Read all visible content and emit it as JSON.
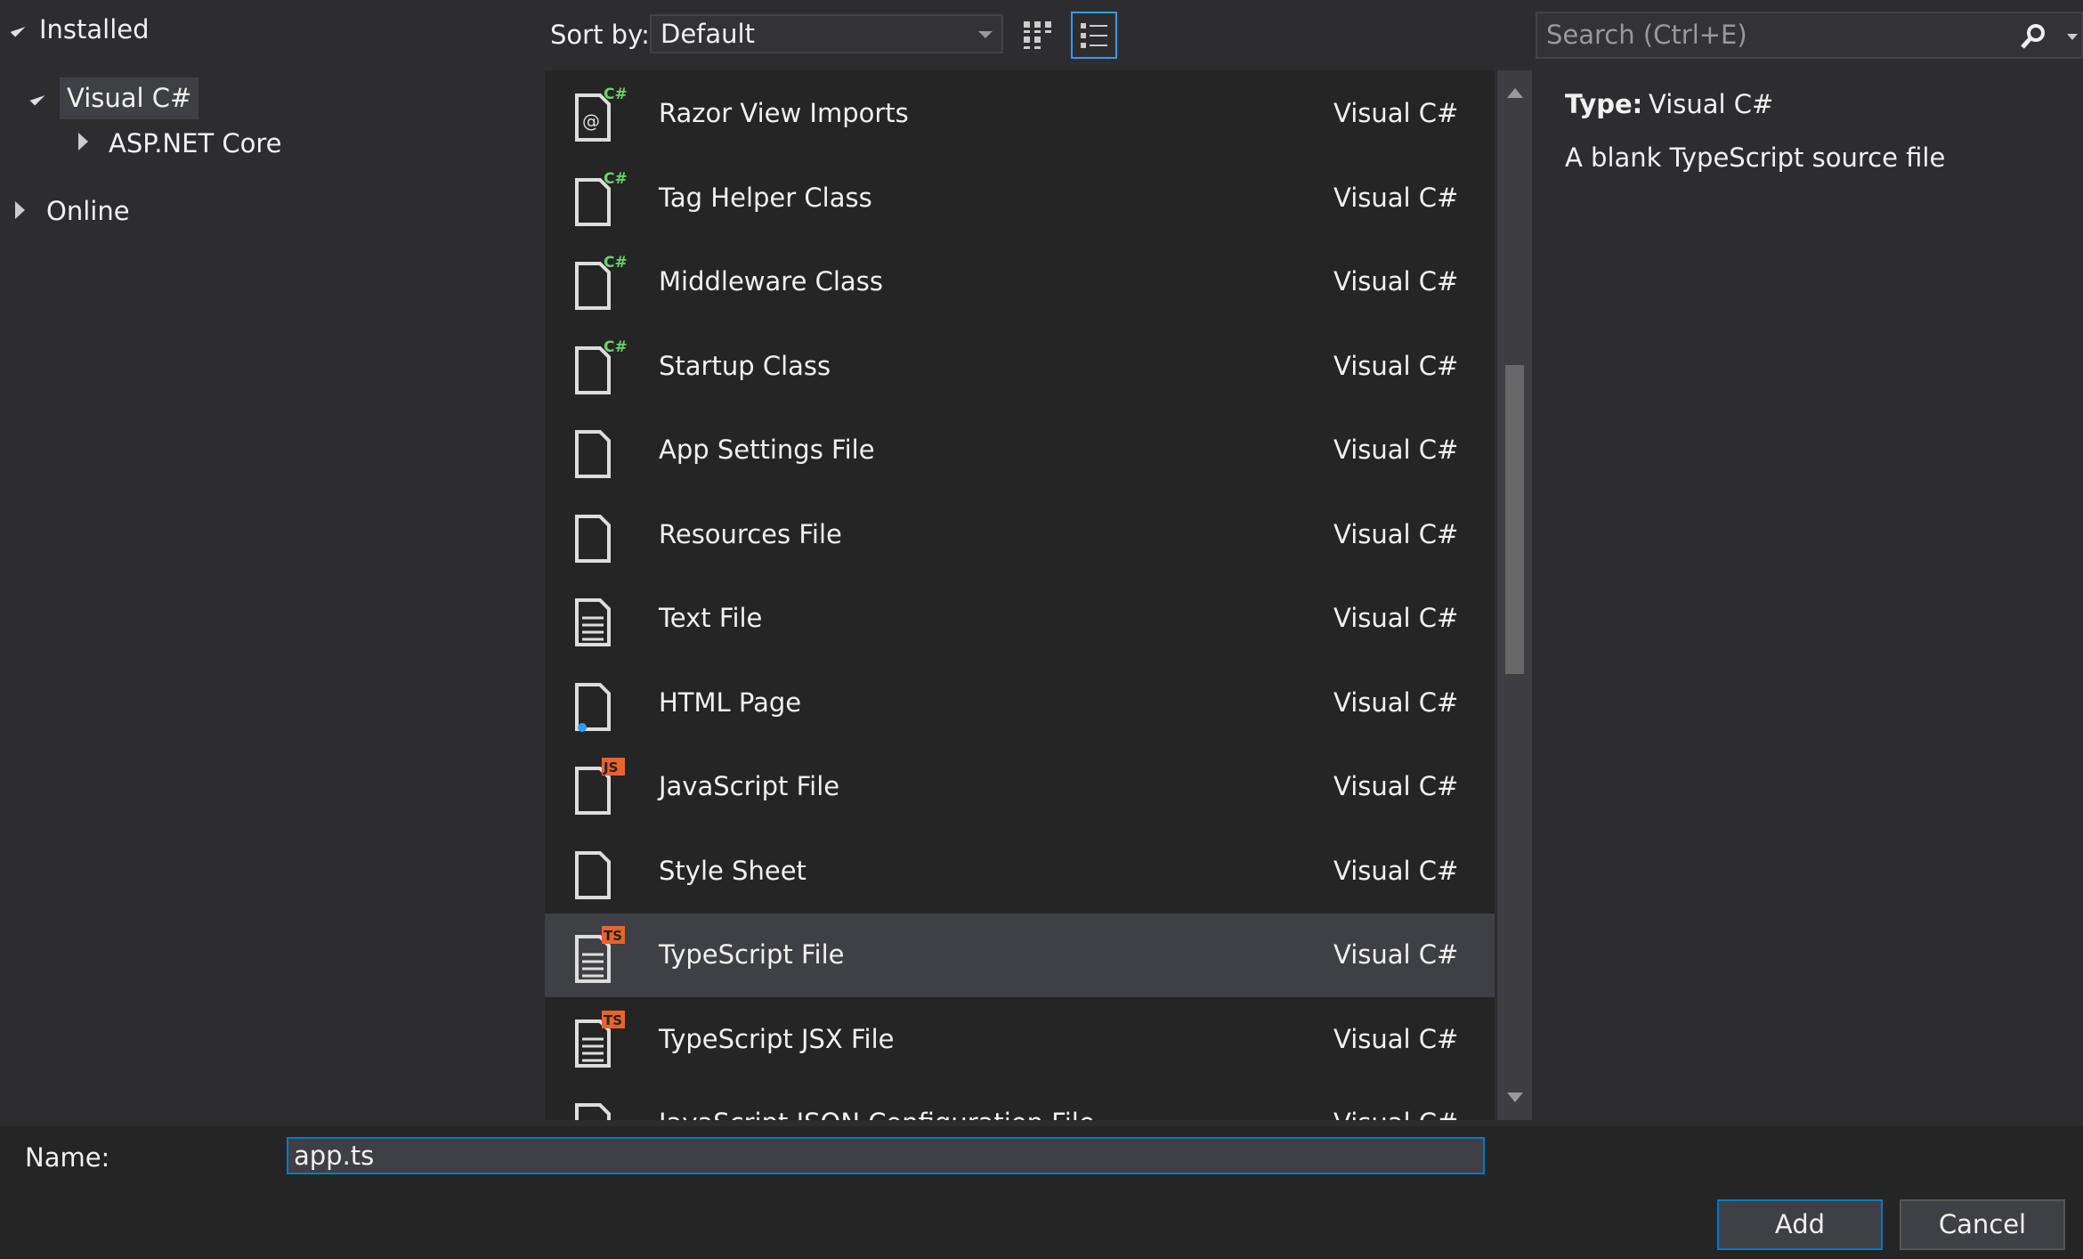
{
  "tree": {
    "installed": "Installed",
    "visual_cs": "Visual C#",
    "aspnet": "ASP.NET Core",
    "online": "Online"
  },
  "toolbar": {
    "sort_label": "Sort by:",
    "sort_value": "Default",
    "search_placeholder": "Search (Ctrl+E)"
  },
  "items": [
    {
      "name": "Razor View Imports",
      "type": "Visual C#",
      "badge": "C#",
      "icon": "razor-file-icon"
    },
    {
      "name": "Tag Helper Class",
      "type": "Visual C#",
      "badge": "C#",
      "icon": "class-file-icon"
    },
    {
      "name": "Middleware Class",
      "type": "Visual C#",
      "badge": "C#",
      "icon": "class-file-icon"
    },
    {
      "name": "Startup Class",
      "type": "Visual C#",
      "badge": "C#",
      "icon": "class-file-icon"
    },
    {
      "name": "App Settings File",
      "type": "Visual C#",
      "badge": "",
      "icon": "settings-file-icon"
    },
    {
      "name": "Resources File",
      "type": "Visual C#",
      "badge": "",
      "icon": "resources-file-icon"
    },
    {
      "name": "Text File",
      "type": "Visual C#",
      "badge": "",
      "icon": "text-file-icon"
    },
    {
      "name": "HTML Page",
      "type": "Visual C#",
      "badge": "",
      "icon": "html-file-icon"
    },
    {
      "name": "JavaScript File",
      "type": "Visual C#",
      "badge": "JS",
      "icon": "javascript-file-icon"
    },
    {
      "name": "Style Sheet",
      "type": "Visual C#",
      "badge": "",
      "icon": "stylesheet-file-icon"
    },
    {
      "name": "TypeScript File",
      "type": "Visual C#",
      "badge": "TS",
      "icon": "typescript-file-icon",
      "selected": true
    },
    {
      "name": "TypeScript JSX File",
      "type": "Visual C#",
      "badge": "TS",
      "icon": "typescript-file-icon"
    },
    {
      "name": "JavaScript JSON Configuration File",
      "type": "Visual C#",
      "badge": "",
      "icon": "json-file-icon"
    }
  ],
  "details": {
    "type_label": "Type:",
    "type_value": "Visual C#",
    "description": "A blank TypeScript source file"
  },
  "footer": {
    "name_label": "Name:",
    "name_value": "app.ts",
    "add": "Add",
    "cancel": "Cancel"
  },
  "colors": {
    "accent": "#007acc",
    "csharp_badge": "#6ad36a",
    "ts_badge": "#e8642c",
    "js_badge": "#e8642c"
  }
}
